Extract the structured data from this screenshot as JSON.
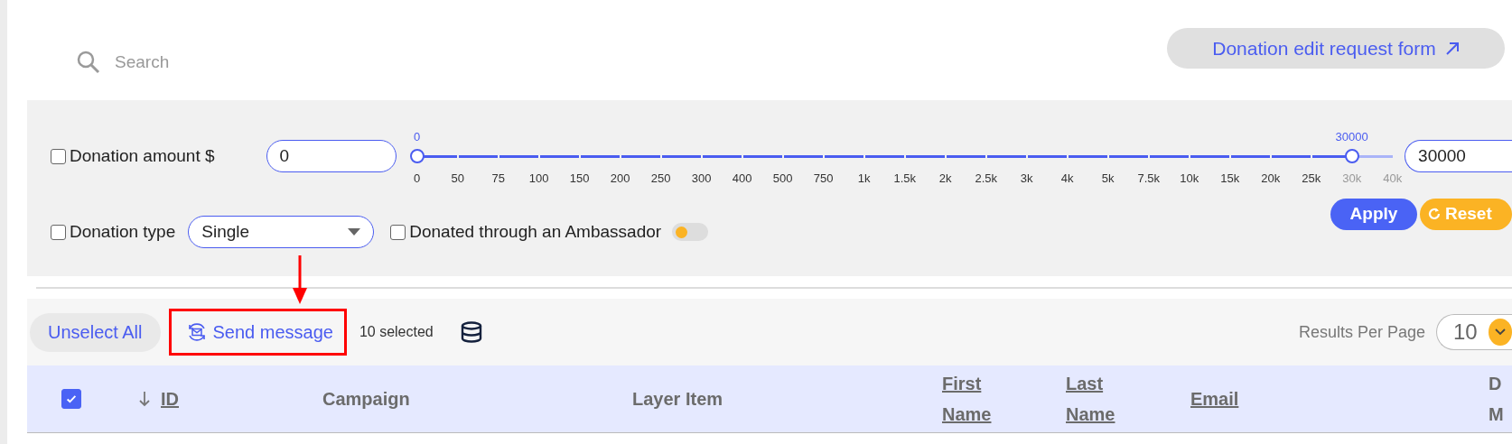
{
  "search": {
    "placeholder": "Search"
  },
  "edit_request_button": {
    "label": "Donation edit request form"
  },
  "filters": {
    "amount": {
      "label": "Donation amount $",
      "checked": false,
      "min_input": "0",
      "max_input": "30000",
      "thumbs": [
        {
          "level": 0,
          "reading": "0"
        },
        {
          "level": 0.9583,
          "reading": "30000"
        }
      ],
      "ticks": [
        "0",
        "50",
        "75",
        "100",
        "150",
        "200",
        "250",
        "300",
        "400",
        "500",
        "750",
        "1k",
        "1.5k",
        "2k",
        "2.5k",
        "3k",
        "4k",
        "5k",
        "7.5k",
        "10k",
        "15k",
        "20k",
        "25k",
        "30k",
        "40k"
      ]
    },
    "type": {
      "label": "Donation type",
      "checked": false,
      "value": "Single"
    },
    "ambassador": {
      "label": "Donated through an Ambassador",
      "checked": false,
      "on": false
    },
    "buttons": [
      {
        "label": "Apply",
        "kind": "apply"
      },
      {
        "label": "Reset",
        "kind": "reset"
      }
    ]
  },
  "toolbar": {
    "unselect": "Unselect All",
    "send_message": {
      "label": "Send message",
      "highlighted": true
    },
    "selected_count": "10 selected",
    "results_label": "Results Per Page",
    "per_page": "10"
  },
  "table": {
    "all_checked": true,
    "columns": [
      {
        "label": "ID",
        "sortable": true,
        "sorted": true
      },
      {
        "label": "Campaign",
        "sortable": false,
        "sorted": false
      },
      {
        "label": "Layer Item",
        "sortable": false,
        "sorted": false
      },
      {
        "label": "First Name",
        "sortable": true,
        "sorted": false
      },
      {
        "label": "Last Name",
        "sortable": true,
        "sorted": false
      },
      {
        "label": "Email",
        "sortable": true,
        "sorted": false
      },
      {
        "label": "D M",
        "sortable": false,
        "sorted": false
      }
    ]
  }
}
